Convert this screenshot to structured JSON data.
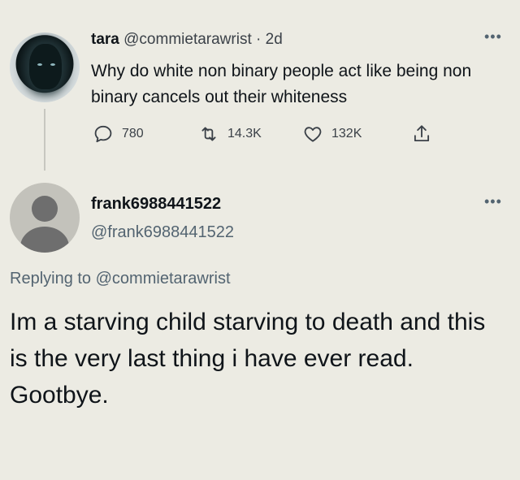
{
  "original_tweet": {
    "author_name": "tara",
    "author_handle": "@commietarawrist",
    "separator": "·",
    "time_ago": "2d",
    "more_icon": "more-horizontal-icon",
    "text": "Why do white non binary people act like being non binary cancels out their whiteness",
    "actions": {
      "replies": "780",
      "retweets": "14.3K",
      "likes": "132K"
    }
  },
  "reply_tweet": {
    "author_name": "frank6988441522",
    "author_handle": "@frank6988441522",
    "more_icon": "more-horizontal-icon",
    "replying_prefix": "Replying to",
    "replying_to": "@commietarawrist",
    "text": "Im a starving child starving to death and this is the very last thing i have ever read. Gootbye."
  },
  "colors": {
    "background": "#ecebe3",
    "primary_text": "#0f1419",
    "secondary_text": "#536471"
  }
}
